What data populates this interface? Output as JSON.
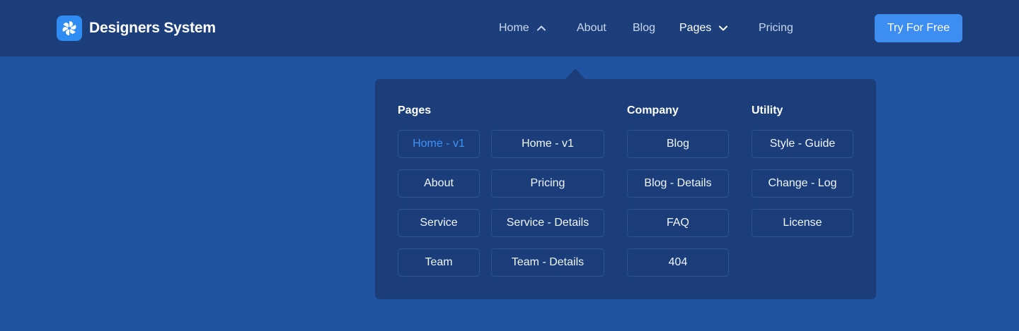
{
  "brand": {
    "name": "Designers System",
    "logo_icon": "pinwheel-icon"
  },
  "nav": {
    "home": "Home",
    "about": "About",
    "blog": "Blog",
    "pages": "Pages",
    "pricing": "Pricing"
  },
  "cta": {
    "label": "Try For Free"
  },
  "colors": {
    "background": "#2154a0",
    "navbar": "#1c3f7c",
    "dropdown": "#1b3e7b",
    "accent": "#3d8ef0",
    "active_link": "#3f93f5"
  },
  "dropdown": {
    "pages": {
      "title": "Pages",
      "links": [
        "Home - v1",
        "Home - v1",
        "About",
        "Pricing",
        "Service",
        "Service - Details",
        "Team",
        "Team - Details"
      ],
      "active": "Home - v1"
    },
    "company": {
      "title": "Company",
      "links": [
        "Blog",
        "Blog - Details",
        "FAQ",
        "404"
      ]
    },
    "utility": {
      "title": "Utility",
      "links": [
        "Style - Guide",
        "Change - Log",
        "License"
      ]
    }
  }
}
